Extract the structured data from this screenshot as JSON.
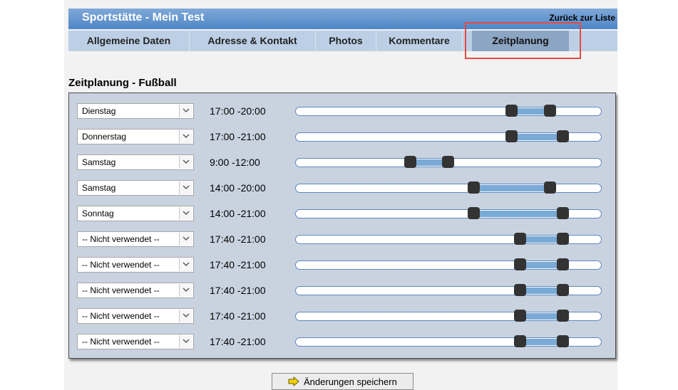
{
  "header": {
    "title": "Sportstätte - Mein Test",
    "back_link": "Zurück zur Liste"
  },
  "tabs": [
    {
      "label": "Allgemeine Daten",
      "active": false
    },
    {
      "label": "Adresse & Kontakt",
      "active": false
    },
    {
      "label": "Photos",
      "active": false
    },
    {
      "label": "Kommentare",
      "active": false
    },
    {
      "label": "Zeitplanung",
      "active": true
    }
  ],
  "section": {
    "title": "Zeitplanung - Fußball"
  },
  "slider_range": {
    "min_hour": 0,
    "max_hour": 24
  },
  "schedule": [
    {
      "day": "Dienstag",
      "time_text": "17:00 -20:00",
      "start": 17,
      "end": 20
    },
    {
      "day": "Donnerstag",
      "time_text": "17:00 -21:00",
      "start": 17,
      "end": 21
    },
    {
      "day": "Samstag",
      "time_text": "9:00 -12:00",
      "start": 9,
      "end": 12
    },
    {
      "day": "Samstag",
      "time_text": "14:00 -20:00",
      "start": 14,
      "end": 20
    },
    {
      "day": "Sonntag",
      "time_text": "14:00 -21:00",
      "start": 14,
      "end": 21
    },
    {
      "day": "-- Nicht verwendet --",
      "time_text": "17:40 -21:00",
      "start": 17.667,
      "end": 21
    },
    {
      "day": "-- Nicht verwendet --",
      "time_text": "17:40 -21:00",
      "start": 17.667,
      "end": 21
    },
    {
      "day": "-- Nicht verwendet --",
      "time_text": "17:40 -21:00",
      "start": 17.667,
      "end": 21
    },
    {
      "day": "-- Nicht verwendet --",
      "time_text": "17:40 -21:00",
      "start": 17.667,
      "end": 21
    },
    {
      "day": "-- Nicht verwendet --",
      "time_text": "17:40 -21:00",
      "start": 17.667,
      "end": 21
    }
  ],
  "save_button": {
    "label": "Änderungen speichern",
    "icon": "arrow-right-icon"
  },
  "colors": {
    "header": "#4f86c6",
    "tab_active": "#8ba5c3",
    "panel": "#c9d3e0",
    "range": "#7aaad6",
    "highlight": "#e64a45"
  }
}
